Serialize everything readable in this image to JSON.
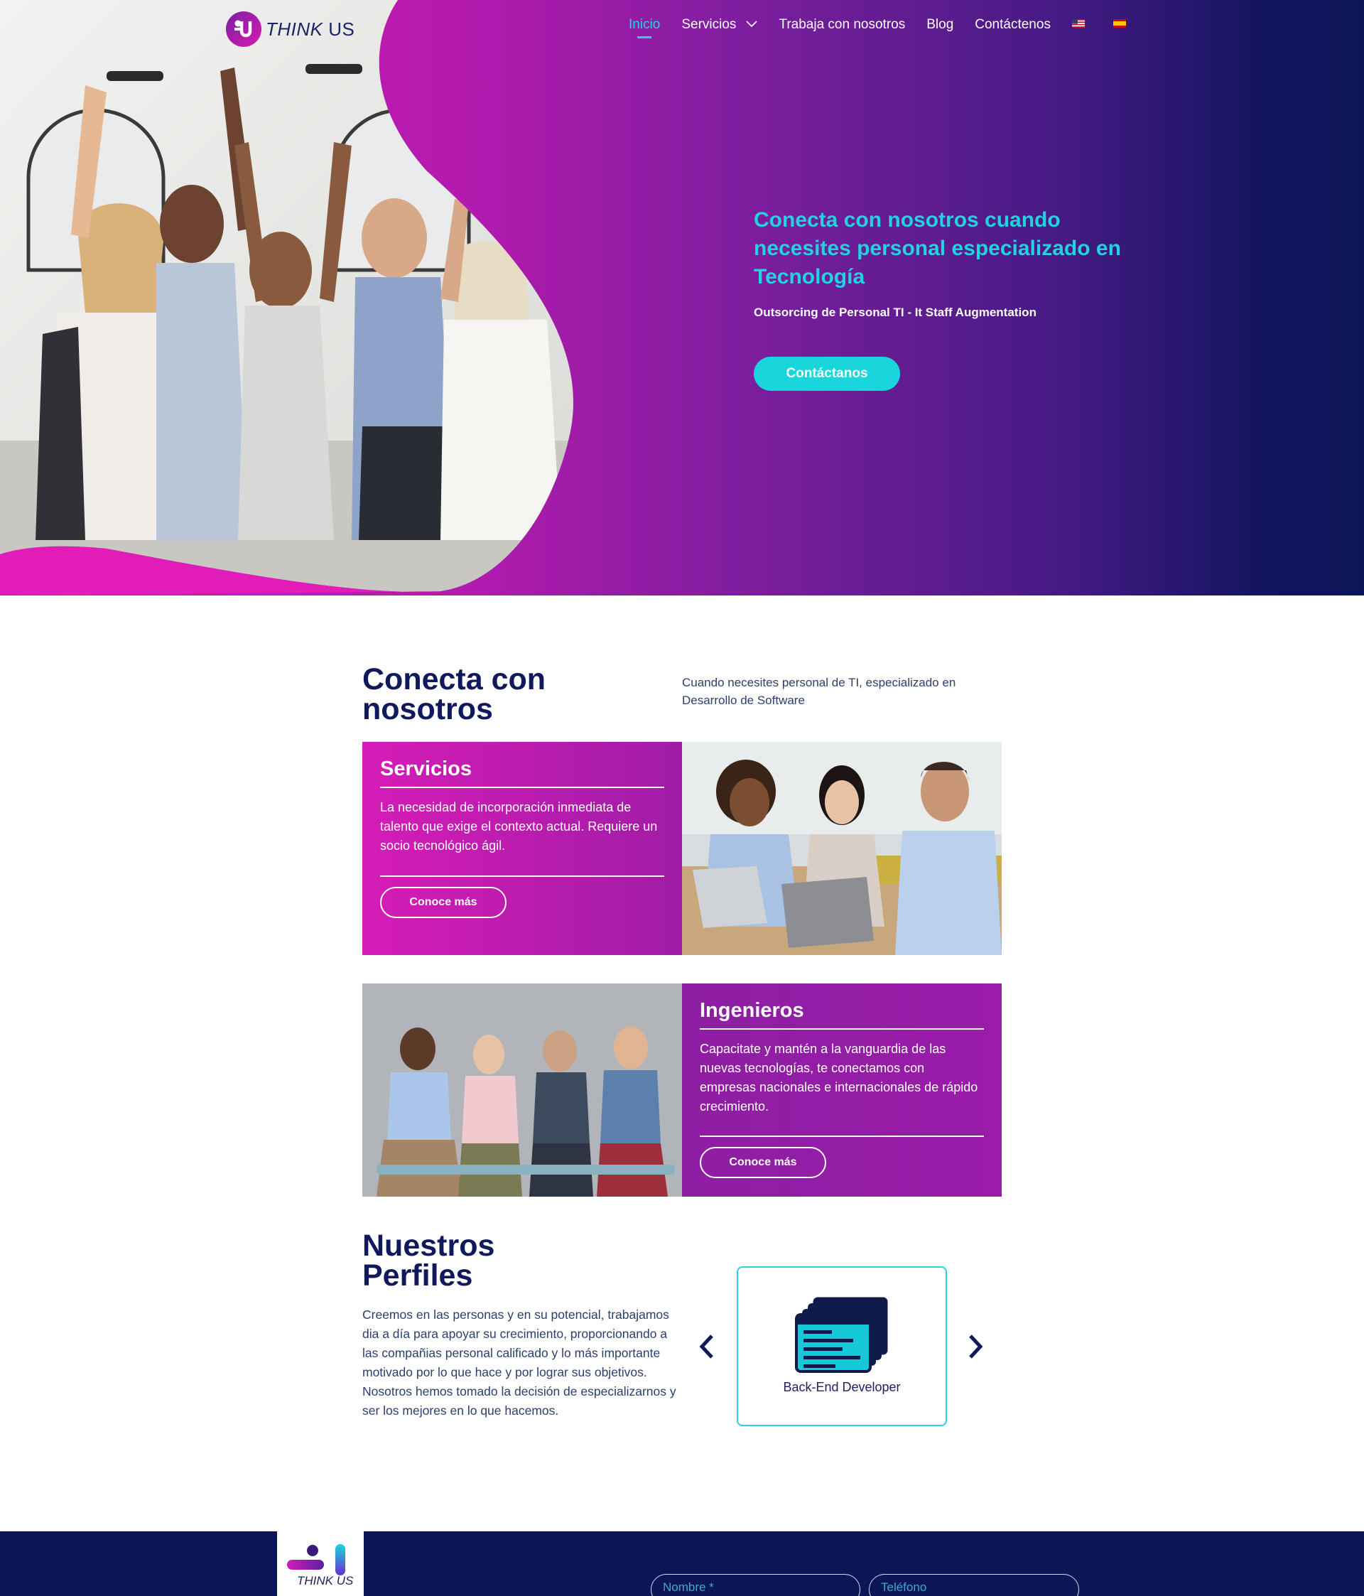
{
  "header": {
    "logo_text_a": "THINK",
    "logo_text_b": "US",
    "nav": [
      {
        "label": "Inicio",
        "active": true
      },
      {
        "label": "Servicios",
        "has_dropdown": true
      },
      {
        "label": "Trabaja con nosotros"
      },
      {
        "label": "Blog"
      },
      {
        "label": "Contáctenos"
      }
    ],
    "languages": [
      "us-flag-icon",
      "spain-flag-icon"
    ]
  },
  "hero": {
    "title": "Conecta con nosotros cuando necesites personal especializado en Tecnología",
    "subtitle": "Outsorcing de Personal TI - It Staff Augmentation",
    "cta": "Contáctanos"
  },
  "connect": {
    "title": "Conecta con nosotros",
    "description": "Cuando necesites personal de TI, especializado en Desarrollo de Software"
  },
  "services_card": {
    "title": "Servicios",
    "text": "La necesidad de incorporación inmediata de talento que exige el contexto actual.  Requiere un socio tecnológico ágil.",
    "button": "Conoce más"
  },
  "engineers_card": {
    "title": "Ingenieros",
    "text": "Capacitate y mantén a la vanguardia de las nuevas tecnologías, te conectamos con empresas nacionales e internacionales de rápido crecimiento.",
    "button": "Conoce más"
  },
  "profiles": {
    "title": "Nuestros Perfiles",
    "text": "Creemos en las personas y en su potencial, trabajamos dia a día para apoyar su crecimiento, proporcionando a las compañias personal calificado y lo más importante motivado por lo que hace y por lograr sus objetivos. Nosotros hemos tomado la decisión de especializarnos y ser los mejores en lo que hacemos.",
    "carousel_item": "Back-End Developer",
    "carousel_icon": "code-window-icon"
  },
  "footer": {
    "logo_text": "THINK US",
    "name_placeholder": "Nombre *",
    "phone_placeholder": "Teléfono"
  },
  "colors": {
    "magenta": "#d61cb8",
    "purple": "#8e1ea4",
    "navy": "#0c1657",
    "cyan": "#24d1de"
  }
}
